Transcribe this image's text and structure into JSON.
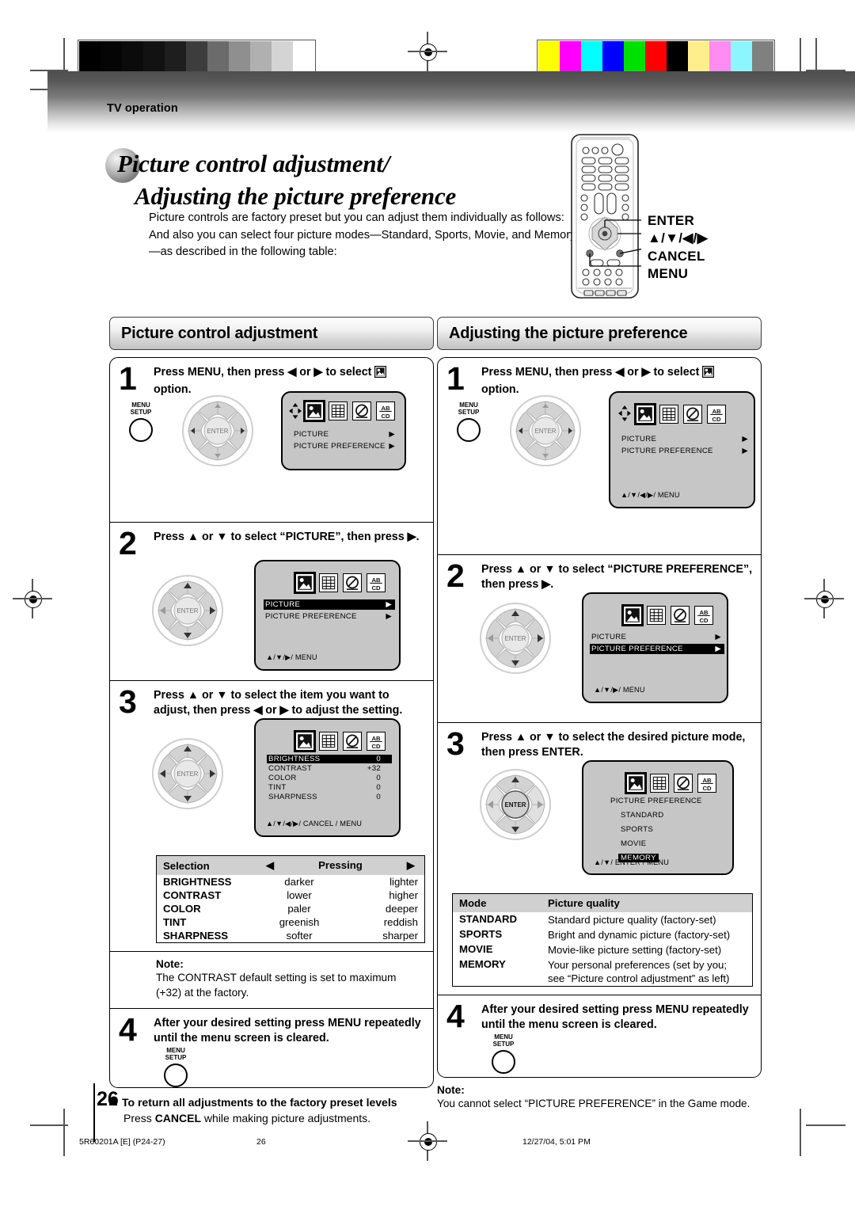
{
  "page": {
    "section_label": "TV operation",
    "title_line1": "Picture control adjustment/",
    "title_line2": "Adjusting the picture preference",
    "intro": "Picture controls are factory preset but you can adjust them individually as follows: And also you can select four picture modes—Standard, Sports, Movie, and Memory—as described in the following table:",
    "page_number": "26"
  },
  "remote_callouts": [
    "ENTER",
    "▲/▼/◀/▶",
    "CANCEL",
    "MENU"
  ],
  "left_column": {
    "heading": "Picture control adjustment",
    "steps": [
      {
        "num": "1",
        "text_a": "Press MENU, then press ◀ or ▶ to select ",
        "text_b": " option.",
        "menu_button": [
          "MENU",
          "SETUP"
        ],
        "osd": {
          "lines": [
            {
              "label": "PICTURE",
              "arrow": "▶",
              "highlight": false
            },
            {
              "label": "PICTURE  PREFERENCE",
              "arrow": "▶",
              "highlight": false
            }
          ],
          "footer": "",
          "selected_icon": 0,
          "show_dpad_glyph": true
        }
      },
      {
        "num": "2",
        "text_a": "Press ▲ or ▼ to select “PICTURE”, then press ▶.",
        "osd": {
          "lines": [
            {
              "label": "PICTURE",
              "arrow": "▶",
              "highlight": true
            },
            {
              "label": "PICTURE  PREFERENCE",
              "arrow": "▶",
              "highlight": false
            }
          ],
          "footer": "▲/▼/▶/ MENU",
          "selected_icon": 0,
          "show_dpad_glyph": false
        }
      },
      {
        "num": "3",
        "text_a": "Press ▲ or ▼ to select the item you want to adjust, then press ◀ or ▶ to adjust the setting.",
        "osd": {
          "lines": [
            {
              "label": "BRIGHTNESS",
              "value": "0",
              "highlight": true
            },
            {
              "label": "CONTRAST",
              "value": "+32",
              "highlight": false
            },
            {
              "label": "COLOR",
              "value": "0",
              "highlight": false
            },
            {
              "label": "TINT",
              "value": "0",
              "highlight": false
            },
            {
              "label": "SHARPNESS",
              "value": "0",
              "highlight": false
            }
          ],
          "footer": "▲/▼/◀/▶/ CANCEL / MENU",
          "selected_icon": 0,
          "show_dpad_glyph": false
        }
      },
      {
        "num": "4",
        "text_a": "After your desired setting press MENU repeatedly until the menu screen is cleared.",
        "menu_button": [
          "MENU",
          "SETUP"
        ]
      }
    ],
    "selection_table": {
      "headers": [
        "Selection",
        "◀   Pressing   ▶"
      ],
      "col_header_left": "Selection",
      "col_header_mid": "Pressing",
      "rows": [
        {
          "selection": "BRIGHTNESS",
          "left": "darker",
          "right": "lighter"
        },
        {
          "selection": "CONTRAST",
          "left": "lower",
          "right": "higher"
        },
        {
          "selection": "COLOR",
          "left": "paler",
          "right": "deeper"
        },
        {
          "selection": "TINT",
          "left": "greenish",
          "right": "reddish"
        },
        {
          "selection": "SHARPNESS",
          "left": "softer",
          "right": "sharper"
        }
      ]
    },
    "note": {
      "title": "Note:",
      "body": "The CONTRAST default setting is set to maximum (+32) at the factory."
    },
    "footer_note": {
      "heading": "To return all adjustments to the factory preset levels",
      "body_a": "Press ",
      "body_b": "CANCEL",
      "body_c": " while making picture adjustments."
    }
  },
  "right_column": {
    "heading": "Adjusting the picture preference",
    "steps": [
      {
        "num": "1",
        "text_a": "Press MENU, then press ◀ or ▶ to select ",
        "text_b": " option.",
        "menu_button": [
          "MENU",
          "SETUP"
        ],
        "osd": {
          "lines": [
            {
              "label": "PICTURE",
              "arrow": "▶",
              "highlight": false
            },
            {
              "label": "PICTURE  PREFERENCE",
              "arrow": "▶",
              "highlight": false
            }
          ],
          "footer": "▲/▼/◀/▶/ MENU",
          "selected_icon": 0,
          "show_dpad_glyph": true
        }
      },
      {
        "num": "2",
        "text_a": "Press ▲ or ▼ to select “PICTURE PREFERENCE”, then press ▶.",
        "osd": {
          "lines": [
            {
              "label": "PICTURE",
              "arrow": "▶",
              "highlight": false
            },
            {
              "label": "PICTURE  PREFERENCE",
              "arrow": "▶",
              "highlight": true
            }
          ],
          "footer": "▲/▼/▶/ MENU",
          "selected_icon": 0,
          "show_dpad_glyph": false
        }
      },
      {
        "num": "3",
        "text_a": "Press ▲ or ▼ to select the desired picture mode, then press ENTER.",
        "osd": {
          "title": "PICTURE PREFERENCE",
          "lines": [
            {
              "label": "STANDARD",
              "highlight": false
            },
            {
              "label": "SPORTS",
              "highlight": false
            },
            {
              "label": "MOVIE",
              "highlight": false
            },
            {
              "label": "MEMORY",
              "highlight": true
            }
          ],
          "footer": "▲/▼/ ENTER / MENU",
          "selected_icon": 0,
          "show_dpad_glyph": false
        }
      },
      {
        "num": "4",
        "text_a": "After your desired setting press MENU repeatedly until the menu screen is cleared.",
        "menu_button": [
          "MENU",
          "SETUP"
        ]
      }
    ],
    "mode_table": {
      "headers": [
        "Mode",
        "Picture quality"
      ],
      "rows": [
        {
          "mode": "STANDARD",
          "quality": "Standard picture quality (factory-set)"
        },
        {
          "mode": "SPORTS",
          "quality": "Bright and dynamic picture (factory-set)"
        },
        {
          "mode": "MOVIE",
          "quality": "Movie-like picture setting (factory-set)"
        },
        {
          "mode": "MEMORY",
          "quality": "Your personal preferences (set by you; see “Picture control adjustment” as left)"
        }
      ]
    },
    "note": {
      "title": "Note:",
      "body": "You cannot select “PICTURE PREFERENCE” in the Game mode."
    }
  },
  "print_footer": {
    "doc_code": "5R60201A [E] (P24-27)",
    "page": "26",
    "timestamp": "12/27/04, 5:01 PM"
  },
  "test_bars": {
    "grayscale": [
      "#000000",
      "#050505",
      "#0b0b0b",
      "#121212",
      "#1e1e1e",
      "#3d3d3d",
      "#6b6b6b",
      "#8f8f8f",
      "#b0b0b0",
      "#d4d4d4",
      "#ffffff"
    ],
    "color": [
      "#ffff00",
      "#ff00ff",
      "#00ffff",
      "#0000ff",
      "#00e000",
      "#ff0000",
      "#000000",
      "#ffef8c",
      "#ff8cf0",
      "#8cf6ff",
      "#808080"
    ]
  },
  "osd_icon_names": [
    "picture-icon",
    "setup-grid-icon",
    "lock-icon",
    "captions-icon"
  ]
}
